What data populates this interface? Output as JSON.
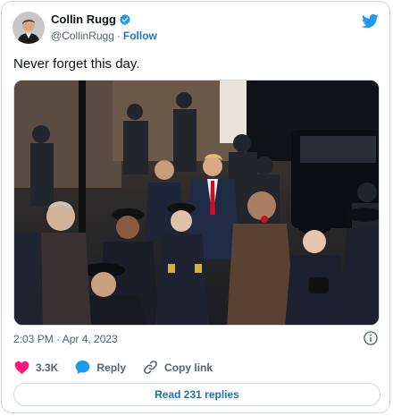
{
  "author": {
    "display_name": "Collin Rugg",
    "handle": "@CollinRugg",
    "separator": "·",
    "follow_label": "Follow"
  },
  "tweet": {
    "text": "Never forget this day.",
    "timestamp": "2:03 PM · Apr 4, 2023"
  },
  "actions": {
    "likes": "3.3K",
    "reply_label": "Reply",
    "copy_link_label": "Copy link"
  },
  "replies_button": "Read 231 replies",
  "colors": {
    "accent": "#1d9bf0",
    "like": "#f91880",
    "link": "#1d72b8",
    "muted": "#536471"
  },
  "icons": {
    "verified": "verified-badge-icon",
    "brand": "twitter-bird-icon",
    "info": "info-icon",
    "like": "heart-icon",
    "reply": "speech-bubble-icon",
    "copy": "link-icon"
  }
}
